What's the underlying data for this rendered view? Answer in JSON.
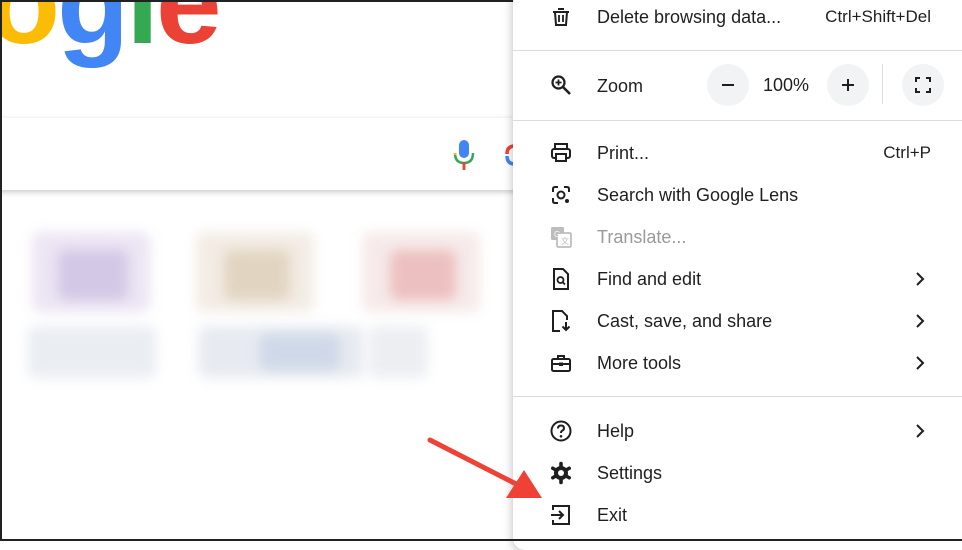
{
  "background": {
    "logo_fragment": "ogle"
  },
  "menu": {
    "items_top": [
      {
        "label": "Delete browsing data...",
        "shortcut": "Ctrl+Shift+Del"
      }
    ],
    "zoom": {
      "label": "Zoom",
      "value": "100%",
      "minus": "−",
      "plus": "+"
    },
    "print": {
      "label": "Print...",
      "shortcut": "Ctrl+P"
    },
    "lens": {
      "label": "Search with Google Lens"
    },
    "translate": {
      "label": "Translate..."
    },
    "find": {
      "label": "Find and edit"
    },
    "cast": {
      "label": "Cast, save, and share"
    },
    "more_tools": {
      "label": "More tools"
    },
    "help": {
      "label": "Help"
    },
    "settings": {
      "label": "Settings"
    },
    "exit": {
      "label": "Exit"
    }
  },
  "colors": {
    "arrow": "#ef4136",
    "google_blue": "#4285f4",
    "google_red": "#ea4335",
    "google_yellow": "#fbbc05",
    "google_green": "#34a853"
  }
}
